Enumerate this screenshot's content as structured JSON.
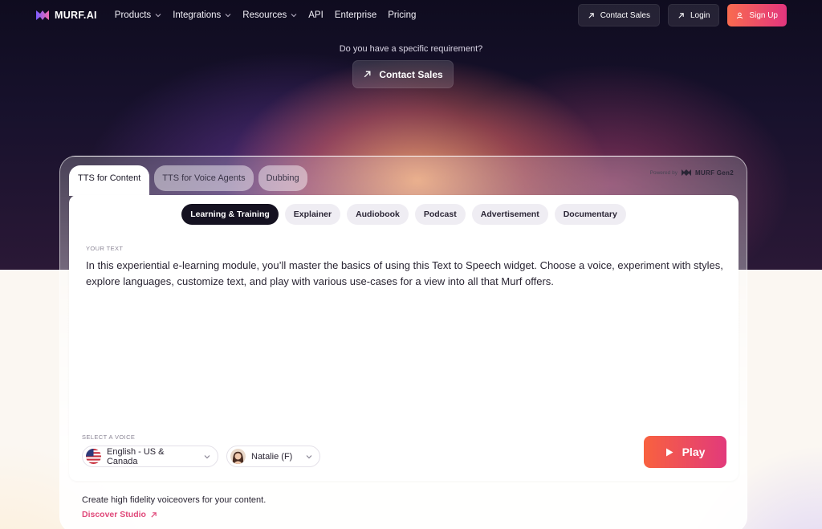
{
  "brand": {
    "name": "MURF.AI"
  },
  "nav": {
    "links": [
      {
        "label": "Products",
        "dropdown": true
      },
      {
        "label": "Integrations",
        "dropdown": true
      },
      {
        "label": "Resources",
        "dropdown": true
      },
      {
        "label": "API",
        "dropdown": false
      },
      {
        "label": "Enterprise",
        "dropdown": false
      },
      {
        "label": "Pricing",
        "dropdown": false
      }
    ],
    "contact_sales": "Contact Sales",
    "login": "Login",
    "signup": "Sign Up"
  },
  "hero": {
    "question": "Do you have a specific requirement?",
    "cta": "Contact Sales"
  },
  "widget": {
    "tabs": [
      "TTS for Content",
      "TTS for Voice Agents",
      "Dubbing"
    ],
    "active_tab": "TTS for Content",
    "powered_by": "Powered by",
    "engine": "MURF Gen2",
    "use_cases": [
      "Learning & Training",
      "Explainer",
      "Audiobook",
      "Podcast",
      "Advertisement",
      "Documentary"
    ],
    "active_use_case": "Learning & Training",
    "text_label": "YOUR TEXT",
    "text": "In this experiential e-learning module, you’ll master the basics of using this Text to Speech widget. Choose a voice, experiment with styles, explore languages, customize text, and play with various use-cases for a view into all that Murf offers.",
    "voice_label": "SELECT A VOICE",
    "language": "English - US & Canada",
    "voice": "Natalie (F)",
    "play": "Play"
  },
  "footer": {
    "tagline": "Create high fidelity voiceovers for your content.",
    "link": "Discover Studio"
  },
  "colors": {
    "accent_start": "#f8613f",
    "accent_end": "#e23a7b",
    "link": "#e0497a",
    "dark": "#151221"
  }
}
